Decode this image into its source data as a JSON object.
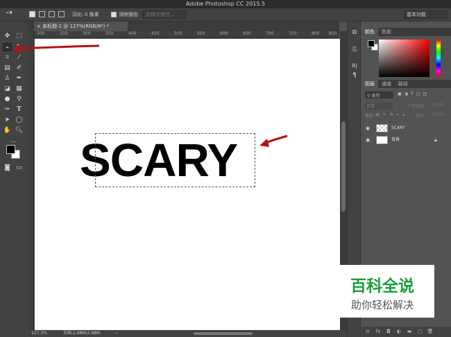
{
  "window": {
    "title": "Adobe Photoshop CC 2015.5"
  },
  "options_bar": {
    "feather_label": "羽化:",
    "feather_value": "0 像素",
    "antialias_label": "消除锯齿",
    "select_mask_label": "选择并遮住...",
    "workspace": "基本功能"
  },
  "document": {
    "tab_label": "未标题-1 @ 127%(RGB/8*) *",
    "canvas_text": "SCARY",
    "zoom": "127.3%",
    "doc_size": "文档:2.98M/2.98M"
  },
  "ruler": {
    "h_ticks": [
      "200",
      "250",
      "300",
      "350",
      "400",
      "450",
      "500",
      "550",
      "600",
      "650",
      "700",
      "750",
      "800",
      "850"
    ]
  },
  "color_panel": {
    "tabs": [
      "颜色",
      "色板"
    ],
    "foreground": "#000000",
    "background": "#ffffff"
  },
  "layers_panel": {
    "tabs": [
      "图层",
      "通道",
      "路径"
    ],
    "filter_label": "类型",
    "blend_mode": "正常",
    "opacity_label": "不透明度:",
    "opacity_value": "100%",
    "lock_label": "锁定:",
    "fill_label": "填充:",
    "fill_value": "100%",
    "layers": [
      {
        "name": "SCARY",
        "kind": "text"
      },
      {
        "name": "背景",
        "kind": "background"
      }
    ]
  },
  "annotations": {
    "arrow_color": "#b31313"
  },
  "watermark": {
    "title": "百科全说",
    "subtitle": "助你轻松解决",
    "title_color": "#1a9e3c"
  }
}
